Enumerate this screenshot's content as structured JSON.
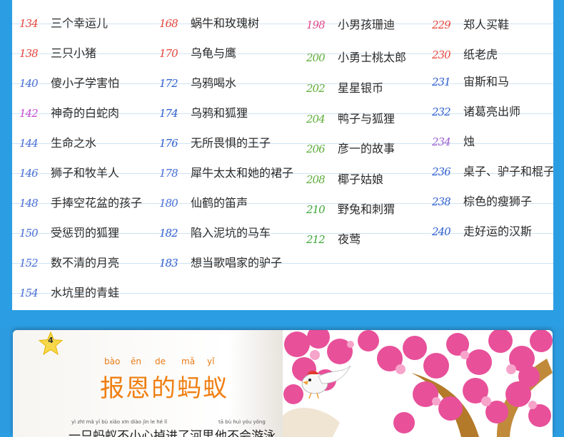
{
  "toc": {
    "columns": [
      {
        "num_color_mode": "mixed",
        "entries": [
          {
            "num": "134",
            "title": "三个幸运儿",
            "color": "#e8473d"
          },
          {
            "num": "138",
            "title": "三只小猪",
            "color": "#e8473d"
          },
          {
            "num": "140",
            "title": "傻小子学害怕",
            "color": "#4a6fd6"
          },
          {
            "num": "142",
            "title": "神奇的白蛇肉",
            "color": "#c94bd1"
          },
          {
            "num": "144",
            "title": "生命之水",
            "color": "#4a6fd6"
          },
          {
            "num": "146",
            "title": "狮子和牧羊人",
            "color": "#4a6fd6"
          },
          {
            "num": "148",
            "title": "手捧空花盆的孩子",
            "color": "#4a6fd6"
          },
          {
            "num": "150",
            "title": "受惩罚的狐狸",
            "color": "#4a6fd6"
          },
          {
            "num": "152",
            "title": "数不清的月亮",
            "color": "#4a6fd6"
          },
          {
            "num": "154",
            "title": "水坑里的青蛙",
            "color": "#4a6fd6"
          }
        ]
      },
      {
        "entries": [
          {
            "num": "168",
            "title": "蜗牛和玫瑰树",
            "color": "#e8473d"
          },
          {
            "num": "170",
            "title": "乌龟与鹰",
            "color": "#e8473d"
          },
          {
            "num": "172",
            "title": "乌鸦喝水",
            "color": "#2f5fd0"
          },
          {
            "num": "174",
            "title": "乌鸦和狐狸",
            "color": "#2f5fd0"
          },
          {
            "num": "176",
            "title": "无所畏惧的王子",
            "color": "#2f5fd0"
          },
          {
            "num": "178",
            "title": "犀牛太太和她的裙子",
            "color": "#4a6fd6"
          },
          {
            "num": "180",
            "title": "仙鹤的笛声",
            "color": "#4a6fd6"
          },
          {
            "num": "182",
            "title": "陷入泥坑的马车",
            "color": "#2f5fd0"
          },
          {
            "num": "183",
            "title": "想当歌唱家的驴子",
            "color": "#2f5fd0"
          }
        ]
      },
      {
        "entries": [
          {
            "num": "198",
            "title": "小男孩珊迪",
            "color": "#e04a8c"
          },
          {
            "num": "200",
            "title": "小勇士桃太郎",
            "color": "#5fae3a"
          },
          {
            "num": "202",
            "title": "星星银币",
            "color": "#5fae3a"
          },
          {
            "num": "204",
            "title": "鸭子与狐狸",
            "color": "#5fae3a"
          },
          {
            "num": "206",
            "title": "彦一的故事",
            "color": "#5fae3a"
          },
          {
            "num": "208",
            "title": "椰子姑娘",
            "color": "#5fae3a"
          },
          {
            "num": "210",
            "title": "野兔和刺猬",
            "color": "#3fa83a"
          },
          {
            "num": "212",
            "title": "夜莺",
            "color": "#3fa83a"
          }
        ]
      },
      {
        "entries": [
          {
            "num": "229",
            "title": "郑人买鞋",
            "color": "#e8473d"
          },
          {
            "num": "230",
            "title": "纸老虎",
            "color": "#e8473d"
          },
          {
            "num": "231",
            "title": "宙斯和马",
            "color": "#2f5fd0"
          },
          {
            "num": "232",
            "title": "诸葛亮出师",
            "color": "#2f5fd0"
          },
          {
            "num": "234",
            "title": "烛",
            "color": "#9a5fd0"
          },
          {
            "num": "236",
            "title": "桌子、驴子和棍子",
            "color": "#2f5fd0"
          },
          {
            "num": "238",
            "title": "棕色的瘦狮子",
            "color": "#2f5fd0"
          },
          {
            "num": "240",
            "title": "走好运的汉斯",
            "color": "#2f5fd0"
          }
        ]
      }
    ]
  },
  "book": {
    "page_number": "4",
    "title_pinyin": [
      "bào",
      "ēn",
      "de",
      "mǎ",
      "yǐ"
    ],
    "title": "报恩的蚂蚁",
    "line_pinyin": "yì zhī mǎ yǐ bù xiǎo xīn diào jìn le hé lǐ",
    "line_pinyin_2": "tā bù huì yóu yǒng",
    "line_text": "一只蚂蚁不小心掉进了河里",
    "line_text_2": "，他不会游泳"
  },
  "colors": {
    "background": "#2b9ee3",
    "title_orange": "#f07f12",
    "blossom_pink": "#e8509a"
  }
}
